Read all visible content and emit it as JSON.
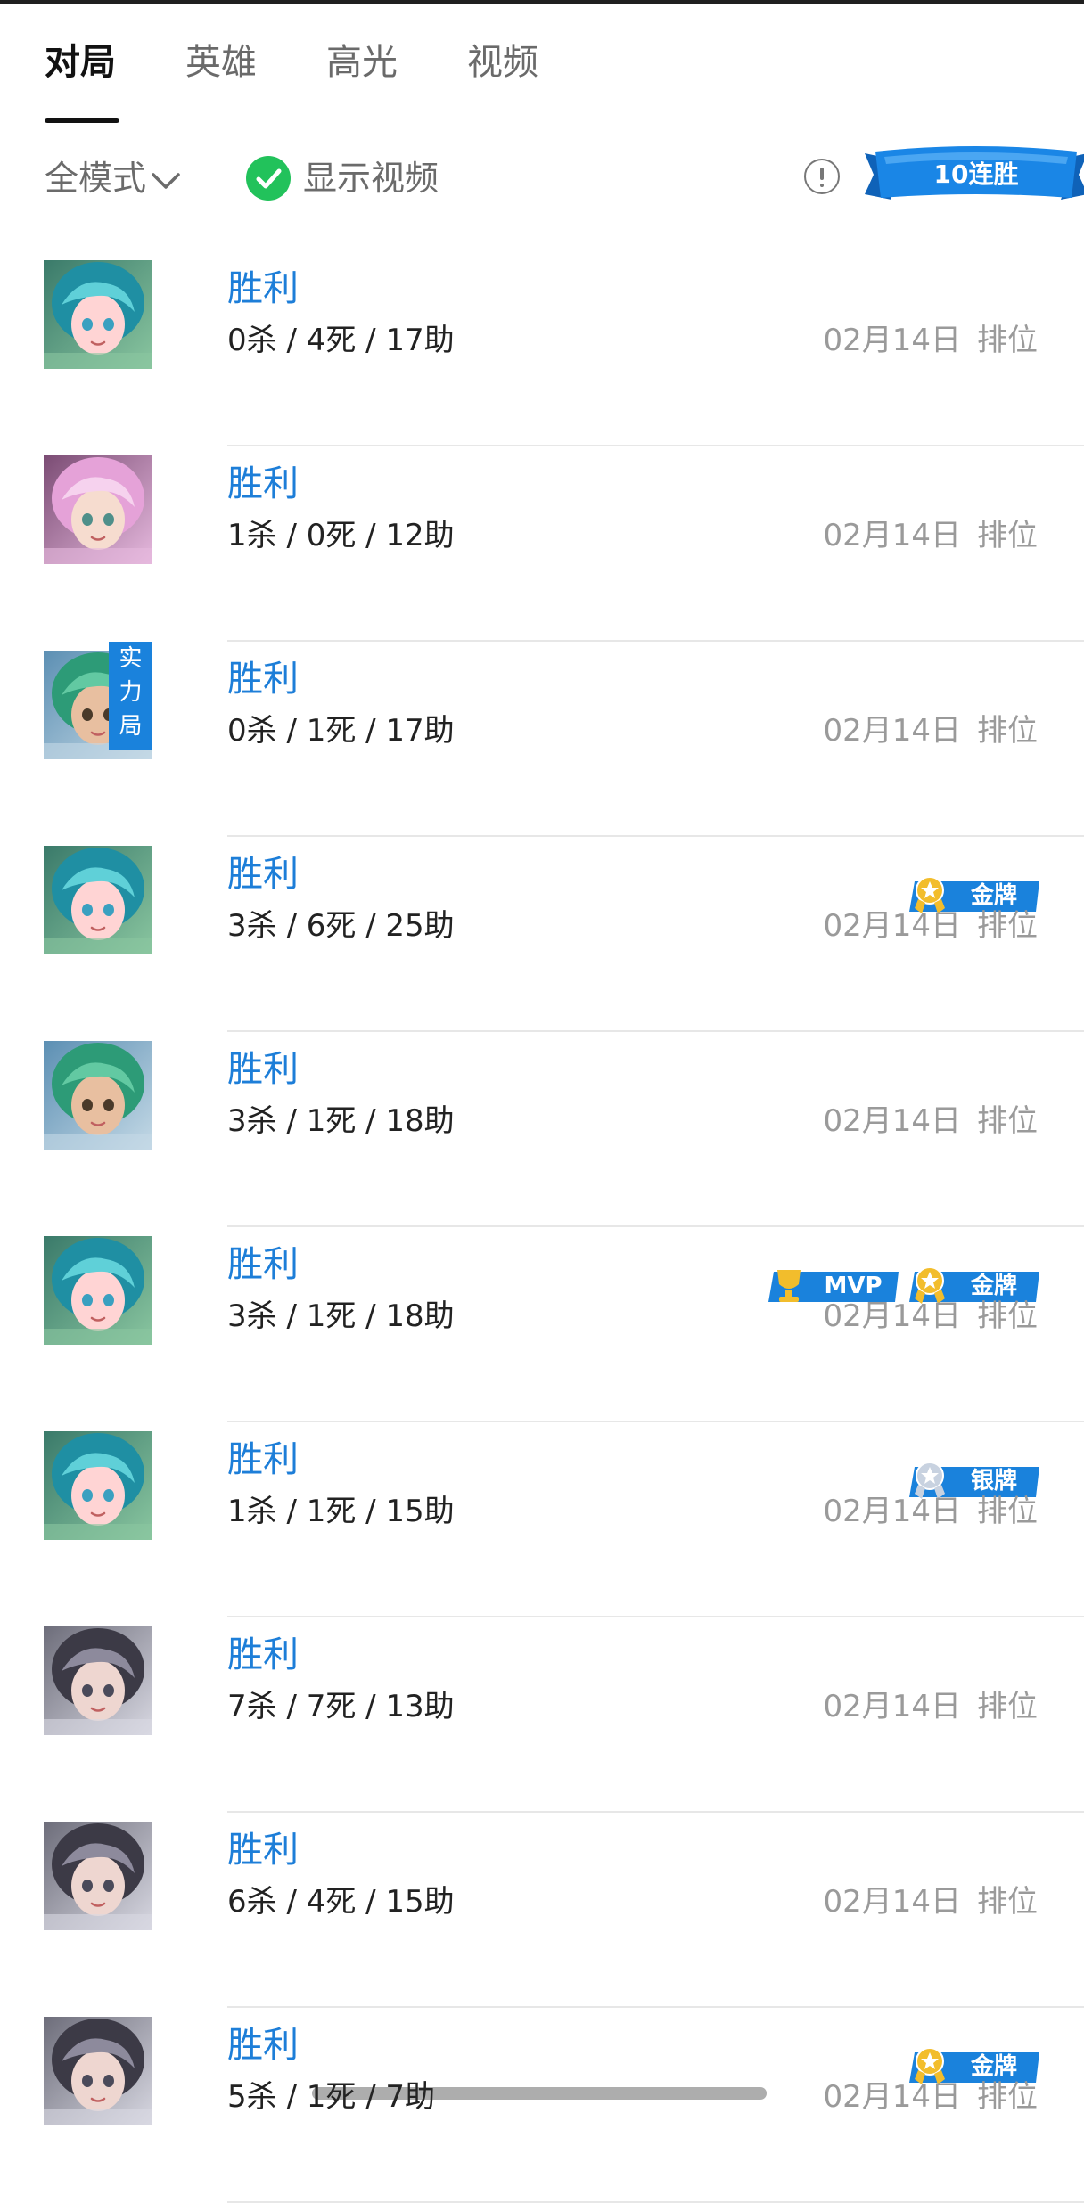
{
  "tabs": [
    {
      "label": "对局",
      "active": true
    },
    {
      "label": "英雄",
      "active": false
    },
    {
      "label": "高光",
      "active": false
    },
    {
      "label": "视频",
      "active": false
    }
  ],
  "filter": {
    "mode_label": "全模式",
    "mode_icon": "chevron-down-icon",
    "show_video_label": "显示视频",
    "show_video_checked": true,
    "info_icon": "info-icon",
    "streak_label": "10连胜"
  },
  "colors": {
    "accent_blue": "#1d7ed8",
    "badge_blue": "#1a82dc",
    "check_green": "#22c25b",
    "gold": "#f2bd2c",
    "silver": "#c8d2e0",
    "muted_text": "#9a9a9a"
  },
  "matches": [
    {
      "result": "胜利",
      "stats": "0杀 / 4死 / 17助",
      "date": "02月14日",
      "mode": "排位",
      "hero_style": "teal-pink",
      "tag": "",
      "badges": []
    },
    {
      "result": "胜利",
      "stats": "1杀 / 0死 / 12助",
      "date": "02月14日",
      "mode": "排位",
      "hero_style": "pink",
      "tag": "",
      "badges": []
    },
    {
      "result": "胜利",
      "stats": "0杀 / 1死 / 17助",
      "date": "02月14日",
      "mode": "排位",
      "hero_style": "green",
      "tag": "实力局",
      "badges": []
    },
    {
      "result": "胜利",
      "stats": "3杀 / 6死 / 25助",
      "date": "02月14日",
      "mode": "排位",
      "hero_style": "teal-pink",
      "tag": "",
      "badges": [
        {
          "label": "金牌",
          "kind": "gold"
        }
      ]
    },
    {
      "result": "胜利",
      "stats": "3杀 / 1死 / 18助",
      "date": "02月14日",
      "mode": "排位",
      "hero_style": "green",
      "tag": "",
      "badges": []
    },
    {
      "result": "胜利",
      "stats": "3杀 / 1死 / 18助",
      "date": "02月14日",
      "mode": "排位",
      "hero_style": "teal-pink",
      "tag": "",
      "badges": [
        {
          "label": "MVP",
          "kind": "mvp"
        },
        {
          "label": "金牌",
          "kind": "gold"
        }
      ]
    },
    {
      "result": "胜利",
      "stats": "1杀 / 1死 / 15助",
      "date": "02月14日",
      "mode": "排位",
      "hero_style": "teal-pink",
      "tag": "",
      "badges": [
        {
          "label": "银牌",
          "kind": "silver"
        }
      ]
    },
    {
      "result": "胜利",
      "stats": "7杀 / 7死 / 13助",
      "date": "02月14日",
      "mode": "排位",
      "hero_style": "grey",
      "tag": "",
      "badges": []
    },
    {
      "result": "胜利",
      "stats": "6杀 / 4死 / 15助",
      "date": "02月14日",
      "mode": "排位",
      "hero_style": "grey",
      "tag": "",
      "badges": []
    },
    {
      "result": "胜利",
      "stats": "5杀 / 1死 / 7助",
      "date": "02月14日",
      "mode": "排位",
      "hero_style": "grey",
      "tag": "",
      "badges": [
        {
          "label": "金牌",
          "kind": "gold"
        }
      ]
    }
  ]
}
